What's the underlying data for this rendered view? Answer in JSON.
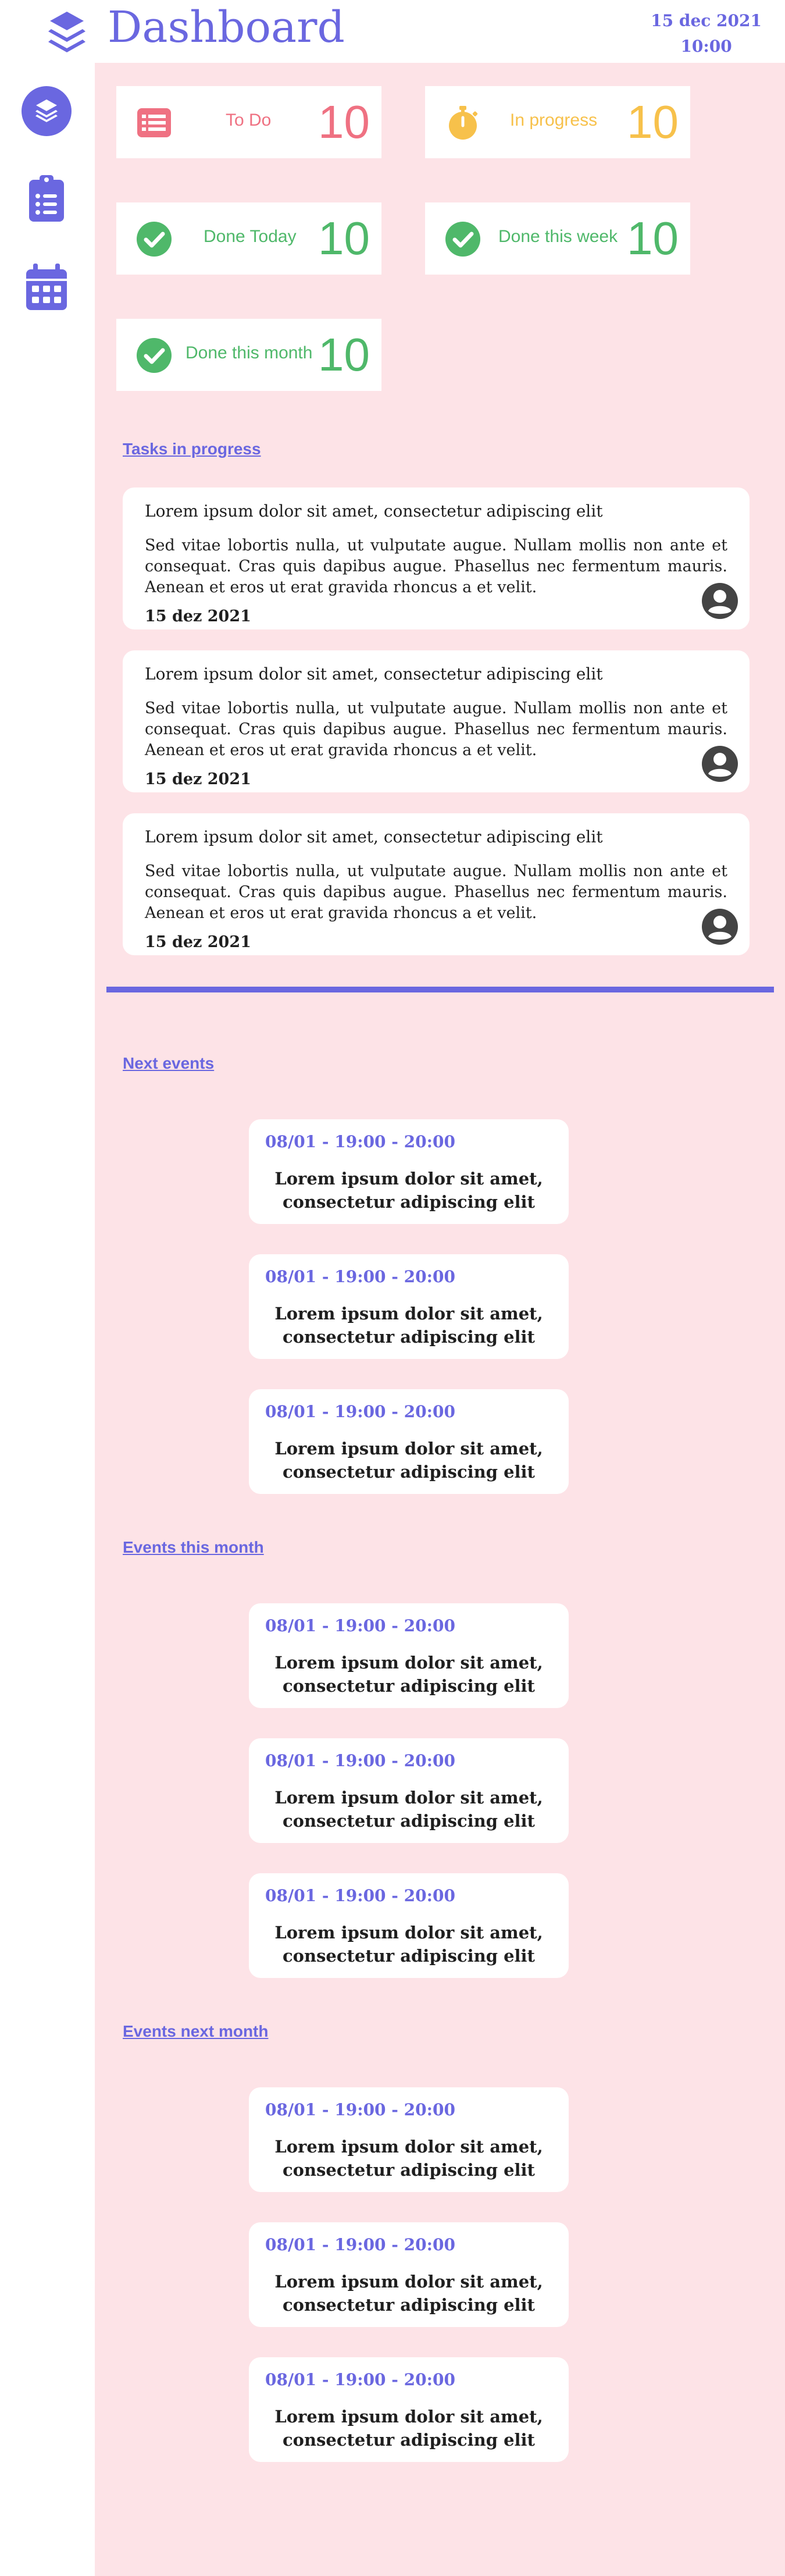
{
  "header": {
    "title": "Dashboard",
    "date": "15 dec 2021",
    "time": "10:00",
    "logo_icon": "layers-icon"
  },
  "sidebar": {
    "items": [
      {
        "name": "dashboard",
        "icon": "layers-icon",
        "active": true
      },
      {
        "name": "tasks",
        "icon": "clipboard-list-icon",
        "active": false
      },
      {
        "name": "calendar",
        "icon": "calendar-icon",
        "active": false
      }
    ]
  },
  "colors": {
    "accent": "#6a67e0",
    "background": "#fde3e7",
    "todo": "#ef7182",
    "in_progress": "#f7c14b",
    "done": "#4fb86a"
  },
  "stats": [
    {
      "label": "To Do",
      "value": "10",
      "icon": "list-icon"
    },
    {
      "label": "In progress",
      "value": "10",
      "icon": "stopwatch-icon"
    },
    {
      "label": "Done Today",
      "value": "10",
      "icon": "check-circle-icon"
    },
    {
      "label": "Done this week",
      "value": "10",
      "icon": "check-circle-icon"
    },
    {
      "label": "Done this month",
      "value": "10",
      "icon": "check-circle-icon"
    }
  ],
  "tasks_section": {
    "title": "Tasks in progress",
    "tasks": [
      {
        "title": "Lorem ipsum dolor sit amet, consectetur adipiscing elit",
        "description": "Sed vitae lobortis nulla, ut vulputate augue. Nullam mollis non ante et consequat. Cras quis dapibus augue. Phasellus nec fermentum mauris. Aenean et eros ut erat gravida rhoncus a et velit.",
        "date": "15 dez 2021"
      },
      {
        "title": "Lorem ipsum dolor sit amet, consectetur adipiscing elit",
        "description": "Sed vitae lobortis nulla, ut vulputate augue. Nullam mollis non ante et consequat. Cras quis dapibus augue. Phasellus nec fermentum mauris. Aenean et eros ut erat gravida rhoncus a et velit.",
        "date": "15 dez 2021"
      },
      {
        "title": "Lorem ipsum dolor sit amet, consectetur adipiscing elit",
        "description": "Sed vitae lobortis nulla, ut vulputate augue. Nullam mollis non ante et consequat. Cras quis dapibus augue. Phasellus nec fermentum mauris. Aenean et eros ut erat gravida rhoncus a et velit.",
        "date": "15 dez 2021"
      }
    ]
  },
  "event_sections": [
    {
      "title": "Next events",
      "events": [
        {
          "time": "08/01 - 19:00 - 20:00",
          "description": "Lorem ipsum dolor sit amet, consectetur adipiscing elit"
        },
        {
          "time": "08/01 - 19:00 - 20:00",
          "description": "Lorem ipsum dolor sit amet, consectetur adipiscing elit"
        },
        {
          "time": "08/01 - 19:00 - 20:00",
          "description": "Lorem ipsum dolor sit amet, consectetur adipiscing elit"
        }
      ]
    },
    {
      "title": "Events this month",
      "events": [
        {
          "time": "08/01 - 19:00 - 20:00",
          "description": "Lorem ipsum dolor sit amet, consectetur adipiscing elit"
        },
        {
          "time": "08/01 - 19:00 - 20:00",
          "description": "Lorem ipsum dolor sit amet, consectetur adipiscing elit"
        },
        {
          "time": "08/01 - 19:00 - 20:00",
          "description": "Lorem ipsum dolor sit amet, consectetur adipiscing elit"
        }
      ]
    },
    {
      "title": "Events next month",
      "events": [
        {
          "time": "08/01 - 19:00 - 20:00",
          "description": "Lorem ipsum dolor sit amet, consectetur adipiscing elit"
        },
        {
          "time": "08/01 - 19:00 - 20:00",
          "description": "Lorem ipsum dolor sit amet, consectetur adipiscing elit"
        },
        {
          "time": "08/01 - 19:00 - 20:00",
          "description": "Lorem ipsum dolor sit amet, consectetur adipiscing elit"
        }
      ]
    }
  ]
}
